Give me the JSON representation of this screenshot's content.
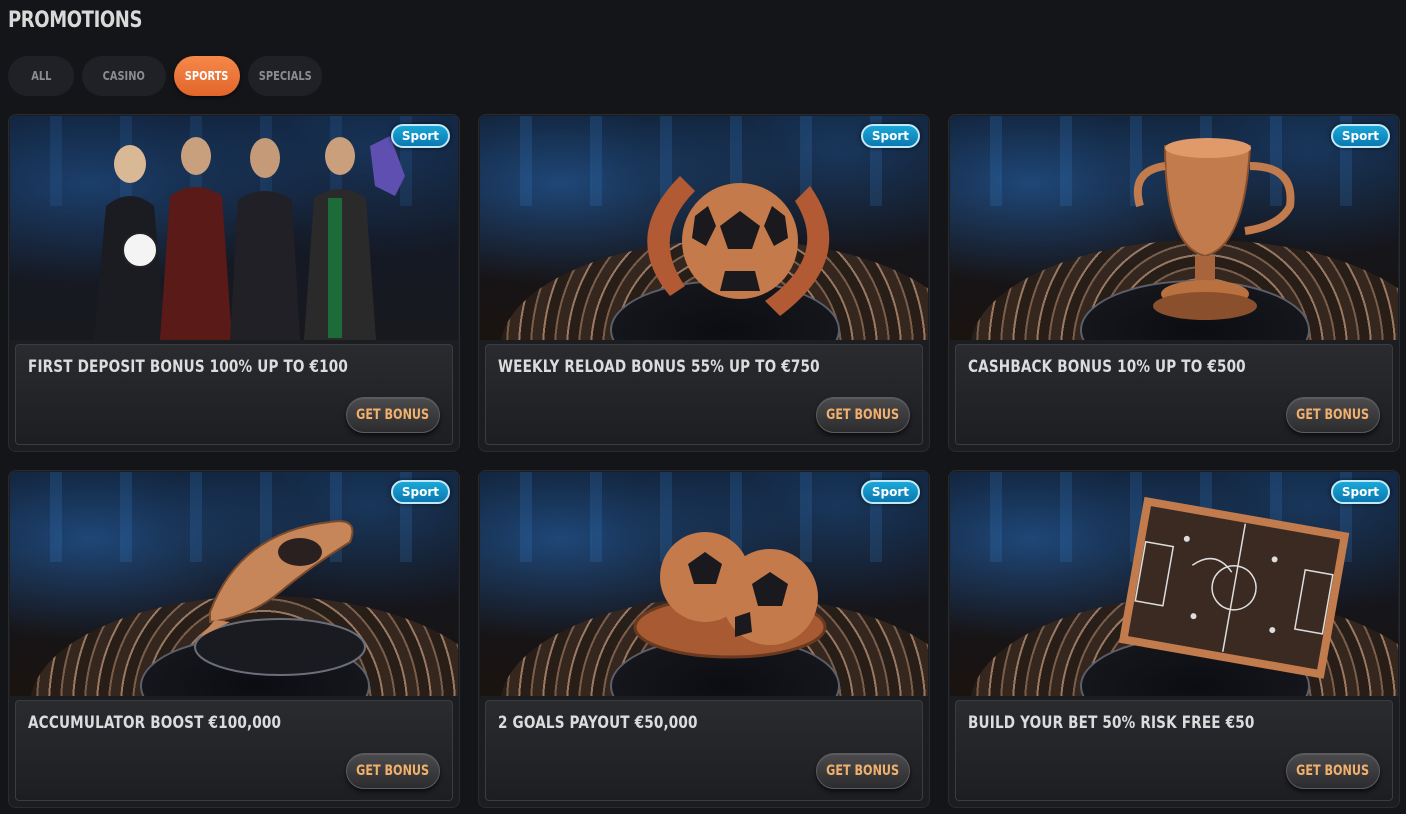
{
  "page": {
    "title": "PROMOTIONS"
  },
  "tabs": [
    {
      "label": "ALL",
      "active": false
    },
    {
      "label": "CASINO",
      "active": false
    },
    {
      "label": "SPORTS",
      "active": true
    },
    {
      "label": "SPECIALS",
      "active": false
    }
  ],
  "colors": {
    "accent": "#f07a3a",
    "badge": "#1596c8",
    "button_text": "#f2b06d",
    "background": "#141519"
  },
  "promotions": [
    {
      "badge": "Sport",
      "title": "FIRST DEPOSIT BONUS 100% UP TO €100",
      "button": "GET BONUS",
      "image_icon": "fans-celebrating-icon"
    },
    {
      "badge": "Sport",
      "title": "WEEKLY RELOAD BONUS 55% UP TO €750",
      "button": "GET BONUS",
      "image_icon": "soccer-ball-reload-icon"
    },
    {
      "badge": "Sport",
      "title": "CASHBACK BONUS 10% UP TO €500",
      "button": "GET BONUS",
      "image_icon": "cashback-trophy-icon"
    },
    {
      "badge": "Sport",
      "title": "ACCUMULATOR BOOST €100,000",
      "button": "GET BONUS",
      "image_icon": "football-boot-icon"
    },
    {
      "badge": "Sport",
      "title": "2 GOALS PAYOUT €50,000",
      "button": "GET BONUS",
      "image_icon": "two-balls-icon"
    },
    {
      "badge": "Sport",
      "title": "BUILD YOUR BET 50% RISK FREE €50",
      "button": "GET BONUS",
      "image_icon": "tactics-board-icon"
    }
  ]
}
